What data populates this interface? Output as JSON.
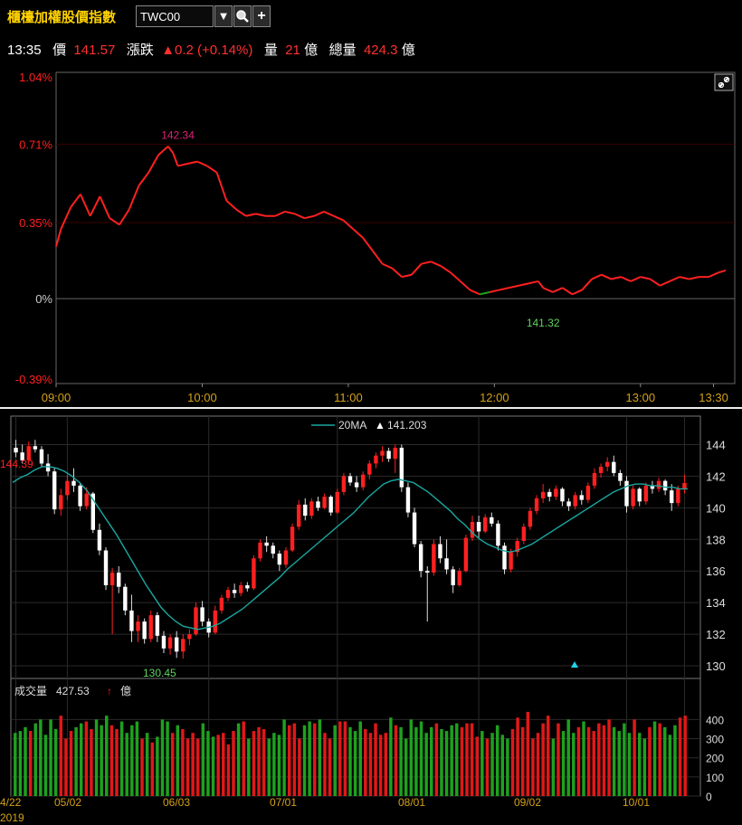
{
  "header": {
    "title": "櫃檯加權股價指數",
    "symbol": "TWC00",
    "dropdown_glyph": "▼",
    "search_icon": "search-icon",
    "add_glyph": "+"
  },
  "quote": {
    "time": "13:35",
    "price_label": "價",
    "price": "141.57",
    "change_label": "漲跌",
    "change": "▲0.2 (+0.14%)",
    "volume_label": "量",
    "volume": "21",
    "volume_unit": "億",
    "total_volume_label": "總量",
    "total_volume": "424.3",
    "total_volume_unit": "億"
  },
  "colors": {
    "up": "#ff2020",
    "down": "#1fa01f",
    "ma": "#1aa7a0",
    "axis": "#d4a017",
    "grid": "#333333"
  },
  "chart_data": [
    {
      "type": "line",
      "title": "",
      "y_labels": [
        "1.04%",
        "0.71%",
        "0.35%",
        "0%",
        "-0.39%"
      ],
      "y_values": [
        1.04,
        0.71,
        0.35,
        0,
        -0.39
      ],
      "x_labels": [
        "09:00",
        "10:00",
        "11:00",
        "12:00",
        "13:00",
        "13:30"
      ],
      "ylim": [
        -0.39,
        1.04
      ],
      "xlim": [
        "09:00",
        "13:35"
      ],
      "annotations": [
        {
          "text": "142.34",
          "time": "09:50",
          "value": 0.71
        },
        {
          "text": "141.32",
          "time": "12:20",
          "value": -0.02
        }
      ],
      "series": [
        {
          "x": [
            "09:00",
            "09:02",
            "09:06",
            "09:10",
            "09:14",
            "09:18",
            "09:22",
            "09:26",
            "09:30",
            "09:34",
            "09:38",
            "09:42",
            "09:46",
            "09:48",
            "09:50",
            "09:54",
            "09:58",
            "10:02",
            "10:06",
            "10:10",
            "10:14",
            "10:18",
            "10:22",
            "10:26",
            "10:30",
            "10:34",
            "10:38",
            "10:42",
            "10:46",
            "10:50",
            "10:54",
            "10:58",
            "11:02",
            "11:06",
            "11:10",
            "11:14",
            "11:18",
            "11:22",
            "11:26",
            "11:30",
            "11:34",
            "11:38",
            "11:42",
            "11:46",
            "11:50",
            "11:54",
            "11:58",
            "12:02",
            "12:06",
            "12:10",
            "12:14",
            "12:18",
            "12:20",
            "12:24",
            "12:28",
            "12:32",
            "12:36",
            "12:40",
            "12:44",
            "12:48",
            "12:52",
            "12:56",
            "13:00",
            "13:04",
            "13:08",
            "13:12",
            "13:16",
            "13:20",
            "13:24",
            "13:28",
            "13:32",
            "13:35"
          ],
          "y": [
            0.24,
            0.32,
            0.42,
            0.48,
            0.38,
            0.47,
            0.37,
            0.34,
            0.41,
            0.52,
            0.58,
            0.66,
            0.7,
            0.67,
            0.61,
            0.62,
            0.63,
            0.61,
            0.58,
            0.45,
            0.41,
            0.38,
            0.39,
            0.38,
            0.38,
            0.4,
            0.39,
            0.37,
            0.38,
            0.4,
            0.38,
            0.36,
            0.32,
            0.28,
            0.22,
            0.16,
            0.14,
            0.1,
            0.11,
            0.16,
            0.17,
            0.15,
            0.12,
            0.08,
            0.04,
            0.02,
            0.03,
            0.04,
            0.05,
            0.06,
            0.07,
            0.08,
            0.05,
            0.03,
            0.05,
            0.02,
            0.04,
            0.09,
            0.11,
            0.09,
            0.1,
            0.08,
            0.1,
            0.09,
            0.06,
            0.08,
            0.1,
            0.09,
            0.1,
            0.1,
            0.12,
            0.13
          ]
        }
      ]
    },
    {
      "type": "candlestick",
      "title": "",
      "legend": [
        {
          "name": "20MA",
          "marker": "▲",
          "value": "141.203"
        }
      ],
      "y_labels": [
        "144",
        "142",
        "140",
        "138",
        "136",
        "134",
        "132",
        "130"
      ],
      "ylim": [
        129.2,
        145.8
      ],
      "x_labels": [
        "4/22",
        "05/02",
        "06/03",
        "07/01",
        "08/01",
        "09/02",
        "10/01"
      ],
      "year_label": "2019",
      "annotations": [
        {
          "text": "144.39",
          "where": "high"
        },
        {
          "text": "130.45",
          "where": "low"
        }
      ],
      "candles": [
        [
          143.8,
          144.3,
          143.2,
          143.5
        ],
        [
          143.5,
          144.0,
          142.8,
          143.0
        ],
        [
          143.0,
          144.2,
          142.9,
          143.9
        ],
        [
          143.9,
          144.3,
          143.5,
          143.7
        ],
        [
          143.7,
          143.9,
          142.6,
          142.8
        ],
        [
          142.8,
          143.4,
          142.0,
          142.3
        ],
        [
          142.3,
          142.5,
          139.6,
          139.9
        ],
        [
          139.9,
          141.2,
          139.5,
          140.8
        ],
        [
          140.8,
          142.1,
          140.5,
          141.7
        ],
        [
          141.7,
          142.5,
          141.0,
          141.4
        ],
        [
          141.4,
          141.6,
          139.8,
          140.1
        ],
        [
          140.1,
          141.3,
          139.9,
          140.9
        ],
        [
          140.9,
          141.0,
          138.4,
          138.6
        ],
        [
          138.6,
          139.0,
          137.0,
          137.3
        ],
        [
          137.3,
          137.5,
          134.8,
          135.1
        ],
        [
          135.1,
          136.2,
          132.0,
          135.9
        ],
        [
          135.9,
          136.3,
          134.6,
          135.0
        ],
        [
          135.0,
          135.2,
          133.2,
          133.5
        ],
        [
          133.5,
          134.5,
          131.5,
          132.2
        ],
        [
          132.2,
          133.2,
          131.5,
          132.8
        ],
        [
          132.8,
          133.0,
          131.4,
          131.7
        ],
        [
          131.7,
          133.5,
          131.5,
          133.2
        ],
        [
          133.2,
          133.4,
          131.5,
          131.9
        ],
        [
          131.9,
          132.2,
          130.8,
          131.1
        ],
        [
          131.1,
          132.0,
          130.7,
          131.8
        ],
        [
          131.8,
          132.2,
          130.5,
          130.9
        ],
        [
          130.9,
          132.0,
          130.45,
          131.7
        ],
        [
          131.7,
          132.3,
          131.3,
          132.0
        ],
        [
          132.0,
          134.0,
          131.9,
          133.7
        ],
        [
          133.7,
          134.1,
          132.5,
          132.8
        ],
        [
          132.8,
          133.0,
          131.8,
          132.1
        ],
        [
          132.1,
          133.8,
          132.0,
          133.5
        ],
        [
          133.5,
          134.5,
          133.3,
          134.3
        ],
        [
          134.3,
          135.0,
          134.1,
          134.8
        ],
        [
          134.8,
          135.2,
          134.3,
          134.6
        ],
        [
          134.6,
          135.3,
          134.4,
          135.1
        ],
        [
          135.1,
          135.3,
          134.7,
          134.9
        ],
        [
          134.9,
          137.0,
          134.8,
          136.8
        ],
        [
          136.8,
          138.0,
          136.6,
          137.8
        ],
        [
          137.8,
          138.2,
          137.2,
          137.6
        ],
        [
          137.6,
          137.8,
          136.8,
          137.1
        ],
        [
          137.1,
          137.3,
          136.0,
          136.4
        ],
        [
          136.4,
          137.5,
          136.2,
          137.3
        ],
        [
          137.3,
          139.0,
          137.2,
          138.8
        ],
        [
          138.8,
          140.5,
          138.6,
          140.2
        ],
        [
          140.2,
          140.6,
          139.2,
          139.5
        ],
        [
          139.5,
          140.6,
          139.3,
          140.4
        ],
        [
          140.4,
          140.7,
          139.8,
          140.0
        ],
        [
          140.0,
          140.9,
          139.9,
          140.7
        ],
        [
          140.7,
          140.8,
          139.5,
          139.7
        ],
        [
          139.7,
          141.2,
          139.6,
          141.0
        ],
        [
          141.0,
          142.2,
          140.8,
          142.0
        ],
        [
          142.0,
          142.2,
          141.4,
          141.6
        ],
        [
          141.6,
          142.0,
          141.0,
          141.3
        ],
        [
          141.3,
          142.3,
          141.1,
          142.1
        ],
        [
          142.1,
          143.0,
          141.8,
          142.8
        ],
        [
          142.8,
          143.5,
          142.5,
          143.3
        ],
        [
          143.3,
          143.9,
          142.9,
          143.6
        ],
        [
          143.6,
          143.8,
          142.9,
          143.1
        ],
        [
          143.1,
          144.0,
          142.2,
          143.8
        ],
        [
          143.8,
          144.0,
          141.0,
          141.3
        ],
        [
          141.3,
          141.6,
          139.4,
          139.7
        ],
        [
          139.7,
          140.0,
          137.5,
          137.7
        ],
        [
          137.7,
          137.9,
          135.6,
          136.0
        ],
        [
          136.0,
          136.3,
          132.8,
          135.9
        ],
        [
          135.9,
          138.0,
          135.7,
          137.7
        ],
        [
          137.7,
          138.2,
          136.5,
          136.8
        ],
        [
          136.8,
          138.0,
          135.8,
          136.1
        ],
        [
          136.1,
          136.3,
          134.6,
          135.1
        ],
        [
          135.1,
          136.2,
          135.0,
          136.0
        ],
        [
          136.0,
          138.3,
          135.9,
          138.1
        ],
        [
          138.1,
          139.5,
          137.9,
          139.1
        ],
        [
          139.1,
          139.5,
          138.1,
          138.5
        ],
        [
          138.5,
          139.6,
          138.4,
          139.4
        ],
        [
          139.4,
          139.7,
          138.8,
          139.0
        ],
        [
          139.0,
          139.2,
          137.3,
          137.6
        ],
        [
          137.6,
          137.8,
          135.8,
          136.1
        ],
        [
          136.1,
          137.4,
          135.9,
          137.2
        ],
        [
          137.2,
          138.1,
          136.9,
          137.9
        ],
        [
          137.9,
          139.0,
          137.7,
          138.8
        ],
        [
          138.8,
          140.0,
          138.6,
          139.8
        ],
        [
          139.8,
          140.8,
          139.6,
          140.6
        ],
        [
          140.6,
          141.5,
          140.3,
          141.0
        ],
        [
          141.0,
          141.2,
          140.4,
          140.7
        ],
        [
          140.7,
          141.4,
          140.5,
          141.2
        ],
        [
          141.2,
          141.3,
          140.1,
          140.4
        ],
        [
          140.4,
          140.6,
          139.8,
          140.1
        ],
        [
          140.1,
          141.0,
          139.9,
          140.8
        ],
        [
          140.8,
          141.1,
          140.2,
          140.5
        ],
        [
          140.5,
          141.6,
          140.3,
          141.4
        ],
        [
          141.4,
          142.5,
          141.2,
          142.2
        ],
        [
          142.2,
          142.8,
          141.9,
          142.6
        ],
        [
          142.6,
          143.2,
          142.3,
          142.9
        ],
        [
          142.9,
          143.3,
          142.0,
          142.2
        ],
        [
          142.2,
          142.4,
          141.4,
          141.7
        ],
        [
          141.7,
          142.0,
          139.7,
          140.1
        ],
        [
          140.1,
          141.4,
          139.9,
          141.2
        ],
        [
          141.2,
          141.3,
          140.1,
          140.4
        ],
        [
          140.4,
          141.6,
          140.2,
          141.4
        ],
        [
          141.4,
          141.7,
          140.9,
          141.2
        ],
        [
          141.2,
          141.9,
          141.0,
          141.7
        ],
        [
          141.7,
          141.8,
          140.8,
          141.1
        ],
        [
          141.1,
          141.5,
          139.8,
          140.3
        ],
        [
          140.3,
          141.4,
          140.1,
          141.2
        ],
        [
          141.2,
          142.1,
          140.9,
          141.57
        ]
      ],
      "ma20": [
        141.6,
        141.9,
        142.1,
        142.4,
        142.6,
        142.6,
        142.5,
        142.3,
        142.0,
        141.6,
        141.1,
        140.4,
        139.7,
        139.0,
        138.3,
        137.5,
        136.7,
        135.9,
        135.1,
        134.4,
        133.7,
        133.2,
        132.8,
        132.5,
        132.4,
        132.3,
        132.4,
        132.5,
        132.7,
        133.0,
        133.3,
        133.6,
        134.0,
        134.4,
        134.8,
        135.2,
        135.6,
        136.1,
        136.5,
        136.9,
        137.3,
        137.7,
        138.1,
        138.5,
        138.9,
        139.3,
        139.7,
        140.2,
        140.7,
        141.1,
        141.5,
        141.7,
        141.8,
        141.7,
        141.6,
        141.3,
        141.0,
        140.6,
        140.2,
        139.8,
        139.3,
        138.9,
        138.4,
        138.0,
        137.7,
        137.5,
        137.3,
        137.2,
        137.3,
        137.5,
        137.7,
        138.0,
        138.3,
        138.6,
        138.9,
        139.2,
        139.5,
        139.8,
        140.1,
        140.4,
        140.7,
        141.0,
        141.2,
        141.4,
        141.5,
        141.5,
        141.4,
        141.4,
        141.3,
        141.3,
        141.2,
        141.2
      ],
      "volume_legend": {
        "label": "成交量",
        "value": "427.53",
        "arrow": "↑",
        "unit": "億"
      },
      "volume_y_labels": [
        "400",
        "300",
        "200",
        "100",
        "0"
      ],
      "volume_ylim": [
        0,
        520
      ],
      "volumes": [
        330,
        340,
        360,
        340,
        380,
        400,
        320,
        400,
        350,
        420,
        300,
        340,
        360,
        380,
        390,
        350,
        400,
        370,
        420,
        370,
        350,
        390,
        330,
        370,
        390,
        300,
        330,
        280,
        310,
        400,
        390,
        330,
        370,
        350,
        300,
        330,
        300,
        380,
        340,
        310,
        320,
        330,
        270,
        340,
        380,
        390,
        300,
        340,
        360,
        350,
        300,
        330,
        320,
        400,
        370,
        380,
        300,
        370,
        390,
        380,
        400,
        330,
        300,
        370,
        390,
        390,
        360,
        340,
        390,
        350,
        330,
        380,
        320,
        330,
        410,
        370,
        360,
        300,
        400,
        360,
        390,
        330,
        360,
        380,
        350,
        340,
        370,
        380,
        360,
        380,
        380,
        310,
        340,
        300,
        330,
        370,
        320,
        300,
        350,
        410,
        360,
        440,
        300,
        330,
        380,
        420,
        300,
        380,
        340,
        400,
        330,
        360,
        390,
        360,
        340,
        380,
        370,
        400,
        360,
        340,
        380,
        330,
        400,
        330,
        300,
        360,
        390,
        380,
        360,
        320,
        370,
        410,
        420
      ]
    }
  ]
}
